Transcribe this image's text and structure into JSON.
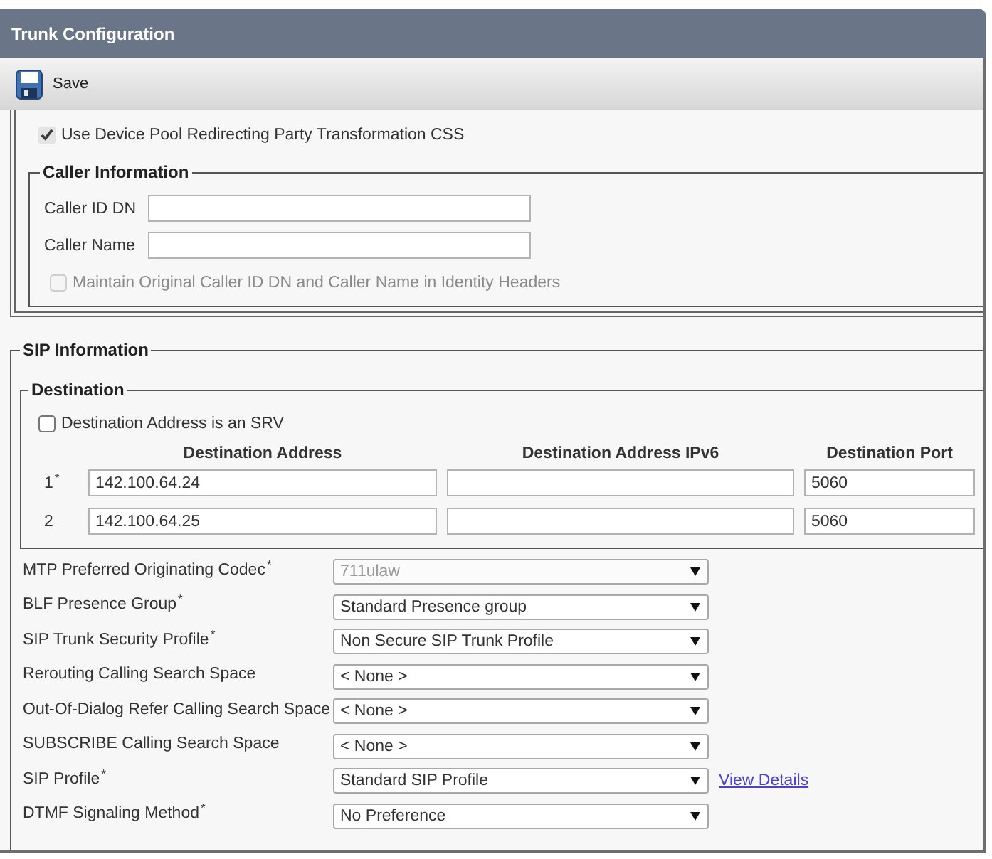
{
  "header": {
    "title": "Trunk Configuration"
  },
  "toolbar": {
    "buttons": [
      {
        "label": "Save",
        "kind": "save"
      }
    ]
  },
  "redirect_settings": {
    "checkbox": {
      "label": "Use Device Pool Redirecting Party Transformation CSS",
      "checked": true,
      "disabled": false
    }
  },
  "caller_information": {
    "legend": "Caller Information",
    "fields": [
      {
        "label": "Caller ID DN"
      },
      {
        "label": "Caller Name"
      }
    ],
    "checkbox": {
      "label": "Maintain Original Caller ID DN and Caller Name in Identity Headers",
      "checked": false,
      "disabled": true
    }
  },
  "sip_information": {
    "legend": "SIP Information",
    "destination": {
      "legend": "Destination",
      "checkbox": {
        "label": "Destination Address is an SRV",
        "checked": false,
        "disabled": false
      },
      "columns": [
        "Destination Address",
        "Destination Address IPv6",
        "Destination Port"
      ],
      "rows": [
        {
          "index": "1$^{*}$",
          "address": "142.100.64.24",
          "port": "5060"
        },
        {
          "index": "2",
          "address": "142.100.64.25",
          "port": "5060"
        }
      ]
    },
    "settings": [
      {
        "label": "MTP Preferred Originating Codec$^{*}$",
        "value": "711ulaw",
        "disabled": true
      },
      {
        "label": "BLF Presence Group$^{*}$",
        "value": "Standard Presence group",
        "disabled": false
      },
      {
        "label": "SIP Trunk Security Profile$^{*}$",
        "value": "Non Secure SIP Trunk Profile",
        "disabled": false
      },
      {
        "label": "Rerouting Calling Search Space",
        "value": "< None >",
        "disabled": false
      },
      {
        "label": "Out-Of-Dialog Refer Calling Search Space",
        "value": "< None >",
        "disabled": false
      },
      {
        "label": "SUBSCRIBE Calling Search Space",
        "value": "< None >",
        "disabled": false
      },
      {
        "label": "SIP Profile$^{*}$",
        "value": "Standard SIP Profile",
        "disabled": false,
        "link": "View Details"
      },
      {
        "label": "DTMF Signaling Method$^{*}$",
        "value": "No Preference",
        "disabled": false
      }
    ]
  }
}
